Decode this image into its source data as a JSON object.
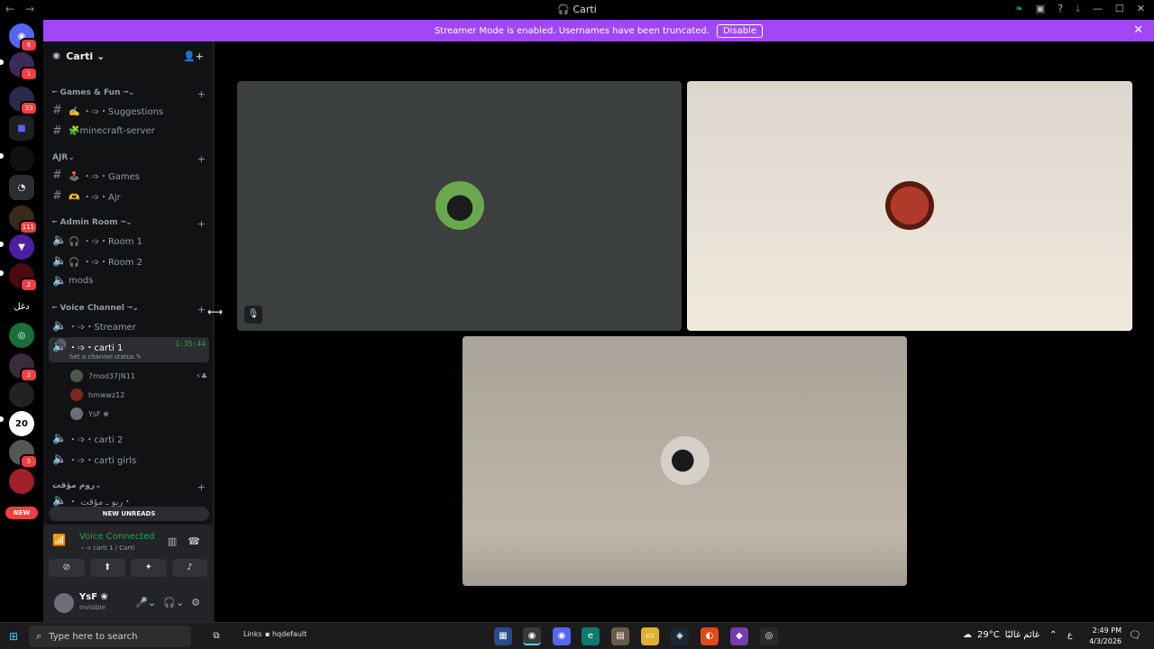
{
  "window": {
    "title": "Carti",
    "back": "←",
    "forward": "→"
  },
  "banner": {
    "text": "Streamer Mode is enabled. Usernames have been truncated.",
    "button": "Disable",
    "close": "✕"
  },
  "servers": {
    "items": [
      {
        "badge": "6"
      },
      {
        "badge": "1"
      },
      {
        "badge": "33"
      },
      {
        "badge": ""
      },
      {
        "badge": ""
      },
      {
        "badge": ""
      },
      {
        "badge": "111"
      },
      {
        "badge": ""
      },
      {
        "badge": "2"
      },
      {
        "badge": ""
      },
      {
        "badge": ""
      },
      {
        "badge": "2"
      },
      {
        "badge": ""
      },
      {
        "badge": "20"
      },
      {
        "badge": "5"
      },
      {
        "badge": ""
      }
    ],
    "new_label": "NEW",
    "arabic_server": "دغل"
  },
  "sidebar": {
    "server_name": "Carti",
    "categories": [
      {
        "label": "╾ Games & Fun ╼"
      },
      {
        "label": "AJR"
      },
      {
        "label": "╾ Admin Room ╼"
      },
      {
        "label": "╾ Voice Channel ╼"
      },
      {
        "label": "روم مؤقت"
      }
    ],
    "channels": [
      {
        "label": "✍️ ・➩・Suggestions"
      },
      {
        "label": "🧩minecraft-server"
      },
      {
        "label": "🕹️ ・➩・Games"
      },
      {
        "label": "🫶 ・➩・Ajr"
      },
      {
        "label": "🎧 ・➩・Room 1"
      },
      {
        "label": "🎧 ・➩・Room 2"
      },
      {
        "label": "mods"
      },
      {
        "label": "・➩・Streamer"
      },
      {
        "label": "・➩・carti 1"
      },
      {
        "label": "・➩・carti 2"
      },
      {
        "label": "・➩・carti girls"
      },
      {
        "label": "・ ریو ـ مؤقت・"
      }
    ],
    "active_timer": "1:35:44",
    "channel_status": "Set a channel status ✎",
    "voice_users": [
      {
        "name": "7mod37|N11"
      },
      {
        "name": "hmwwz12"
      },
      {
        "name": "YsF ❀"
      }
    ],
    "new_unreads": "NEW UNREADS"
  },
  "voice_panel": {
    "title": "Voice Connected",
    "subtitle": "・➩ carti 1 / Carti"
  },
  "user_panel": {
    "name": "YsF ❀",
    "status": "Invisible"
  },
  "taskbar": {
    "search_placeholder": "Type here to search",
    "links": "Links",
    "hqdefault": "hqdefault",
    "temperature": "29°C",
    "weather_text": "غائم غالبًا",
    "lang": "ع",
    "time": "2:49 PM",
    "date": "4/3/2026"
  },
  "colors": {
    "banner": "#a147f5",
    "speaking": "#23a55a",
    "badge": "#f23f42"
  }
}
